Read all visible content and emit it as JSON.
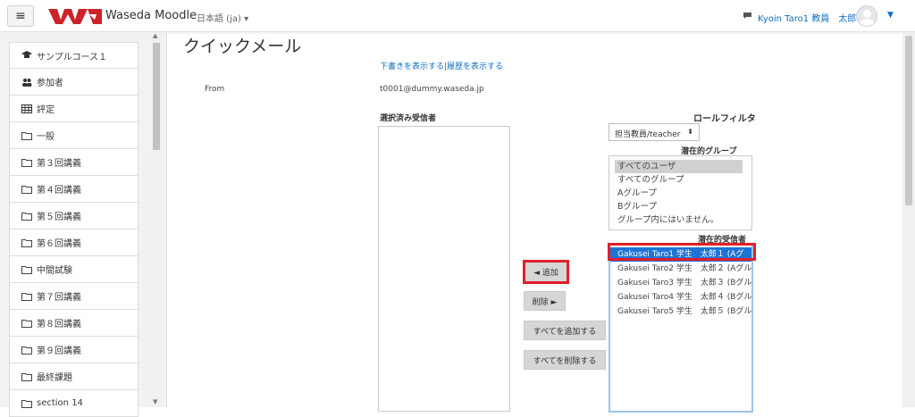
{
  "navbar": {
    "brand": "Waseda Moodle",
    "language": "日本語 (ja)",
    "user_name": "Kyoin Taro1 教員　太郎１"
  },
  "drawer": {
    "items": [
      {
        "label": "サンプルコース１",
        "icon": "graduation-cap-icon"
      },
      {
        "label": "参加者",
        "icon": "users-icon"
      },
      {
        "label": "評定",
        "icon": "grades-table-icon"
      },
      {
        "label": "一般",
        "icon": "folder-icon"
      },
      {
        "label": "第３回講義",
        "icon": "folder-icon"
      },
      {
        "label": "第４回講義",
        "icon": "folder-icon"
      },
      {
        "label": "第５回講義",
        "icon": "folder-icon"
      },
      {
        "label": "第６回講義",
        "icon": "folder-icon"
      },
      {
        "label": "中間試験",
        "icon": "folder-icon"
      },
      {
        "label": "第７回講義",
        "icon": "folder-icon"
      },
      {
        "label": "第８回講義",
        "icon": "folder-icon"
      },
      {
        "label": "第９回講義",
        "icon": "folder-icon"
      },
      {
        "label": "最終課題",
        "icon": "folder-icon"
      },
      {
        "label": "section 14",
        "icon": "folder-icon"
      }
    ]
  },
  "main": {
    "title": "クイックメール",
    "links": "下書きを表示する|履歴を表示する",
    "from_label": "From",
    "from_value": "t0001@dummy.waseda.jp",
    "selected_label": "選択済み受信者",
    "role_filter_label": "ロールフィルタ",
    "role_value": "担当教員/teacher",
    "groups_label": "潜在的グループ",
    "groups": [
      "すべてのユーザ",
      "すべてのグループ",
      "Aグループ",
      "Bグループ",
      "グループ内にはいません。"
    ],
    "selected_group_index": 0,
    "potential_label": "潜在的受信者",
    "recipients": [
      "Gakusei Taro1 学生　太郎１ (Aグ",
      "Gakusei Taro2 学生　太郎２ (Aグル",
      "Gakusei Taro3 学生　太郎３ (Bグル",
      "Gakusei Taro4 学生　太郎４ (Bグル",
      "Gakusei Taro5 学生　太郎５ (Bグル"
    ],
    "selected_recipient_index": 0,
    "buttons": {
      "add": "◄ 追加",
      "remove": "削除 ►",
      "add_all": "すべてを追加する",
      "remove_all": "すべてを削除する"
    }
  },
  "colors": {
    "link": "#0f6fc5",
    "highlight": "#e01f2a",
    "selection": "#1e73d6",
    "logo_red": "#cc2229"
  }
}
